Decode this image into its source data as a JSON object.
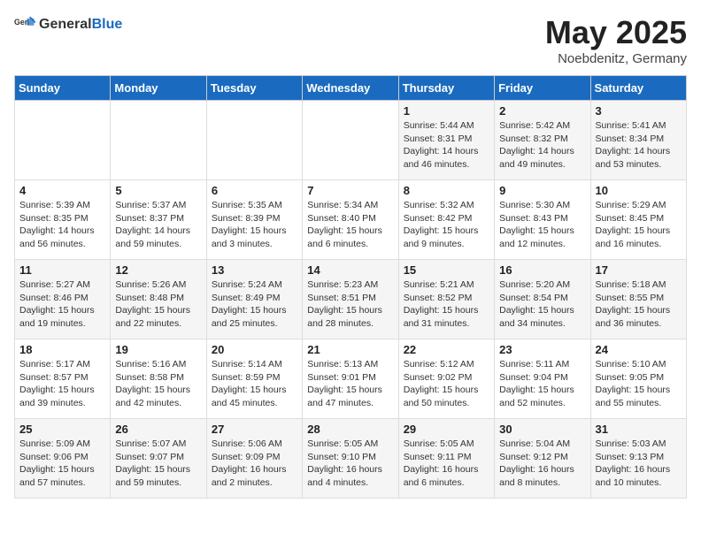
{
  "header": {
    "logo_general": "General",
    "logo_blue": "Blue",
    "month_title": "May 2025",
    "subtitle": "Noebdenitz, Germany"
  },
  "weekdays": [
    "Sunday",
    "Monday",
    "Tuesday",
    "Wednesday",
    "Thursday",
    "Friday",
    "Saturday"
  ],
  "weeks": [
    [
      {
        "day": "",
        "info": ""
      },
      {
        "day": "",
        "info": ""
      },
      {
        "day": "",
        "info": ""
      },
      {
        "day": "",
        "info": ""
      },
      {
        "day": "1",
        "info": "Sunrise: 5:44 AM\nSunset: 8:31 PM\nDaylight: 14 hours\nand 46 minutes."
      },
      {
        "day": "2",
        "info": "Sunrise: 5:42 AM\nSunset: 8:32 PM\nDaylight: 14 hours\nand 49 minutes."
      },
      {
        "day": "3",
        "info": "Sunrise: 5:41 AM\nSunset: 8:34 PM\nDaylight: 14 hours\nand 53 minutes."
      }
    ],
    [
      {
        "day": "4",
        "info": "Sunrise: 5:39 AM\nSunset: 8:35 PM\nDaylight: 14 hours\nand 56 minutes."
      },
      {
        "day": "5",
        "info": "Sunrise: 5:37 AM\nSunset: 8:37 PM\nDaylight: 14 hours\nand 59 minutes."
      },
      {
        "day": "6",
        "info": "Sunrise: 5:35 AM\nSunset: 8:39 PM\nDaylight: 15 hours\nand 3 minutes."
      },
      {
        "day": "7",
        "info": "Sunrise: 5:34 AM\nSunset: 8:40 PM\nDaylight: 15 hours\nand 6 minutes."
      },
      {
        "day": "8",
        "info": "Sunrise: 5:32 AM\nSunset: 8:42 PM\nDaylight: 15 hours\nand 9 minutes."
      },
      {
        "day": "9",
        "info": "Sunrise: 5:30 AM\nSunset: 8:43 PM\nDaylight: 15 hours\nand 12 minutes."
      },
      {
        "day": "10",
        "info": "Sunrise: 5:29 AM\nSunset: 8:45 PM\nDaylight: 15 hours\nand 16 minutes."
      }
    ],
    [
      {
        "day": "11",
        "info": "Sunrise: 5:27 AM\nSunset: 8:46 PM\nDaylight: 15 hours\nand 19 minutes."
      },
      {
        "day": "12",
        "info": "Sunrise: 5:26 AM\nSunset: 8:48 PM\nDaylight: 15 hours\nand 22 minutes."
      },
      {
        "day": "13",
        "info": "Sunrise: 5:24 AM\nSunset: 8:49 PM\nDaylight: 15 hours\nand 25 minutes."
      },
      {
        "day": "14",
        "info": "Sunrise: 5:23 AM\nSunset: 8:51 PM\nDaylight: 15 hours\nand 28 minutes."
      },
      {
        "day": "15",
        "info": "Sunrise: 5:21 AM\nSunset: 8:52 PM\nDaylight: 15 hours\nand 31 minutes."
      },
      {
        "day": "16",
        "info": "Sunrise: 5:20 AM\nSunset: 8:54 PM\nDaylight: 15 hours\nand 34 minutes."
      },
      {
        "day": "17",
        "info": "Sunrise: 5:18 AM\nSunset: 8:55 PM\nDaylight: 15 hours\nand 36 minutes."
      }
    ],
    [
      {
        "day": "18",
        "info": "Sunrise: 5:17 AM\nSunset: 8:57 PM\nDaylight: 15 hours\nand 39 minutes."
      },
      {
        "day": "19",
        "info": "Sunrise: 5:16 AM\nSunset: 8:58 PM\nDaylight: 15 hours\nand 42 minutes."
      },
      {
        "day": "20",
        "info": "Sunrise: 5:14 AM\nSunset: 8:59 PM\nDaylight: 15 hours\nand 45 minutes."
      },
      {
        "day": "21",
        "info": "Sunrise: 5:13 AM\nSunset: 9:01 PM\nDaylight: 15 hours\nand 47 minutes."
      },
      {
        "day": "22",
        "info": "Sunrise: 5:12 AM\nSunset: 9:02 PM\nDaylight: 15 hours\nand 50 minutes."
      },
      {
        "day": "23",
        "info": "Sunrise: 5:11 AM\nSunset: 9:04 PM\nDaylight: 15 hours\nand 52 minutes."
      },
      {
        "day": "24",
        "info": "Sunrise: 5:10 AM\nSunset: 9:05 PM\nDaylight: 15 hours\nand 55 minutes."
      }
    ],
    [
      {
        "day": "25",
        "info": "Sunrise: 5:09 AM\nSunset: 9:06 PM\nDaylight: 15 hours\nand 57 minutes."
      },
      {
        "day": "26",
        "info": "Sunrise: 5:07 AM\nSunset: 9:07 PM\nDaylight: 15 hours\nand 59 minutes."
      },
      {
        "day": "27",
        "info": "Sunrise: 5:06 AM\nSunset: 9:09 PM\nDaylight: 16 hours\nand 2 minutes."
      },
      {
        "day": "28",
        "info": "Sunrise: 5:05 AM\nSunset: 9:10 PM\nDaylight: 16 hours\nand 4 minutes."
      },
      {
        "day": "29",
        "info": "Sunrise: 5:05 AM\nSunset: 9:11 PM\nDaylight: 16 hours\nand 6 minutes."
      },
      {
        "day": "30",
        "info": "Sunrise: 5:04 AM\nSunset: 9:12 PM\nDaylight: 16 hours\nand 8 minutes."
      },
      {
        "day": "31",
        "info": "Sunrise: 5:03 AM\nSunset: 9:13 PM\nDaylight: 16 hours\nand 10 minutes."
      }
    ]
  ]
}
